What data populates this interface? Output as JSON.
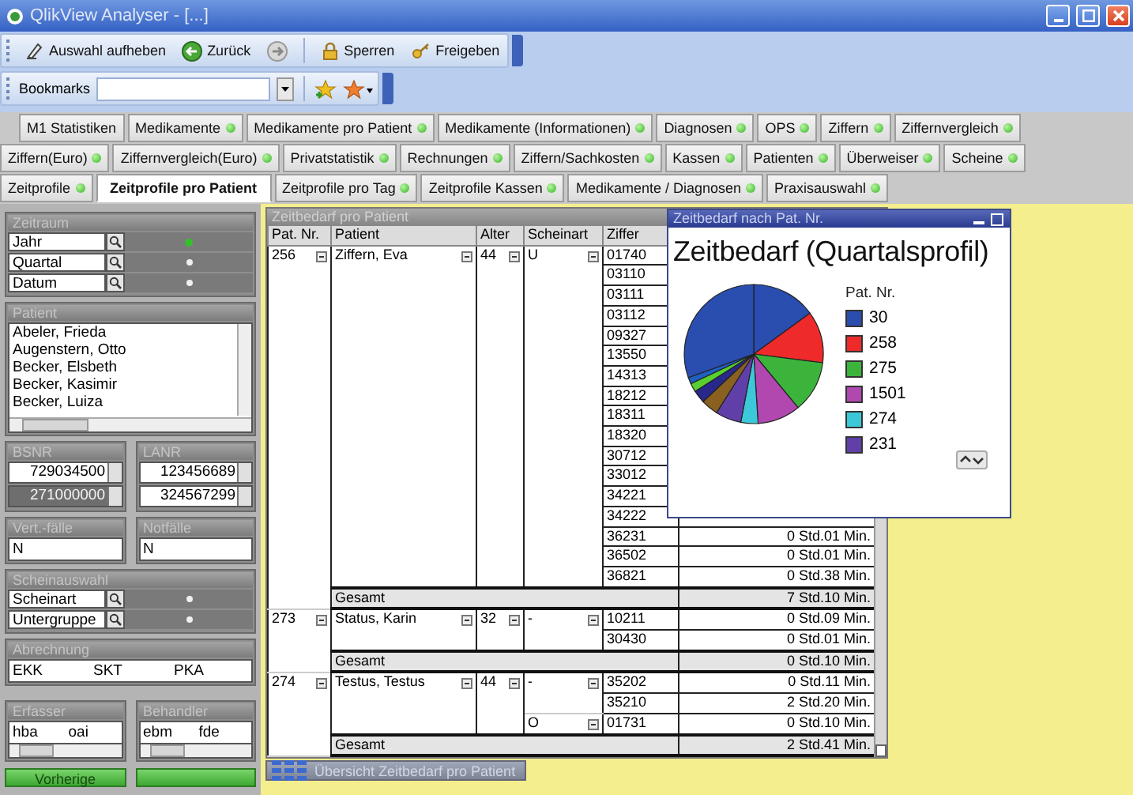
{
  "window": {
    "title": "QlikView Analyser - [...]"
  },
  "toolbar": {
    "groups": [
      [
        {
          "kind": "clear",
          "label": "Auswahl aufheben"
        },
        {
          "kind": "back",
          "label": "Zurück"
        },
        {
          "kind": "forward"
        }
      ],
      [
        {
          "kind": "lock",
          "label": "Sperren"
        },
        {
          "kind": "unlock",
          "label": "Freigeben"
        }
      ]
    ]
  },
  "bookmarks": {
    "label": "Bookmarks"
  },
  "tab_rows": [
    {
      "tabs": [
        {
          "label": "M1 Statistiken",
          "selected": false,
          "dot": false
        },
        {
          "label": "Medikamente",
          "selected": false,
          "dot": true
        },
        {
          "label": "Medikamente pro Patient",
          "selected": false,
          "dot": true
        },
        {
          "label": "Medikamente (Informationen)",
          "selected": false,
          "dot": true
        },
        {
          "label": "Diagnosen",
          "selected": false,
          "dot": true
        },
        {
          "label": "OPS",
          "selected": false,
          "dot": true
        },
        {
          "label": "Ziffern",
          "selected": false,
          "dot": true
        },
        {
          "label": "Ziffernvergleich",
          "selected": false,
          "dot": true
        }
      ]
    },
    {
      "tabs": [
        {
          "label": "Ziffern(Euro)",
          "selected": false,
          "dot": true
        },
        {
          "label": "Ziffernvergleich(Euro)",
          "selected": false,
          "dot": true
        },
        {
          "label": "Privatstatistik",
          "selected": false,
          "dot": true
        },
        {
          "label": "Rechnungen",
          "selected": false,
          "dot": true
        },
        {
          "label": "Ziffern/Sachkosten",
          "selected": false,
          "dot": true
        },
        {
          "label": "Kassen",
          "selected": false,
          "dot": true
        },
        {
          "label": "Patienten",
          "selected": false,
          "dot": true
        },
        {
          "label": "Überweiser",
          "selected": false,
          "dot": true
        },
        {
          "label": "Scheine",
          "selected": false,
          "dot": true
        }
      ]
    },
    {
      "tabs": [
        {
          "label": "Zeitprofile",
          "selected": false,
          "dot": true
        },
        {
          "label": "Zeitprofile pro Patient",
          "selected": true,
          "dot": false
        },
        {
          "label": "Zeitprofile pro Tag",
          "selected": false,
          "dot": true
        },
        {
          "label": "Zeitprofile Kassen",
          "selected": false,
          "dot": true
        },
        {
          "label": "Medikamente / Diagnosen",
          "selected": false,
          "dot": true
        },
        {
          "label": "Praxisauswahl",
          "selected": false,
          "dot": true
        }
      ]
    }
  ],
  "sidebar": {
    "rows": [
      {
        "boxes": [
          {
            "kind": "fields",
            "title": "Zeitraum",
            "fields": [
              {
                "label": "Jahr",
                "active": true
              },
              {
                "label": "Quartal",
                "active": false
              },
              {
                "label": "Datum",
                "active": false
              }
            ]
          }
        ]
      },
      {
        "boxes": [
          {
            "kind": "list",
            "title": "Patient",
            "items": [
              "Abeler, Frieda",
              "Augenstern, Otto",
              "Becker, Elsbeth",
              "Becker, Kasimir",
              "Becker, Luiza"
            ]
          }
        ]
      },
      {
        "boxes": [
          {
            "kind": "stack",
            "title": "BSNR",
            "values": [
              {
                "value": "729034500",
                "excluded": false
              },
              {
                "value": "271000000",
                "excluded": true
              }
            ]
          },
          {
            "kind": "stack",
            "title": "LANR",
            "values": [
              {
                "value": "123456689",
                "excluded": false
              },
              {
                "value": "324567299",
                "excluded": false
              }
            ]
          }
        ]
      },
      {
        "boxes": [
          {
            "kind": "value",
            "title": "Vert.-fälle",
            "value": "N"
          },
          {
            "kind": "value",
            "title": "Notfälle",
            "value": "N"
          }
        ]
      },
      {
        "boxes": [
          {
            "kind": "fields",
            "title": "Scheinauswahl",
            "fields": [
              {
                "label": "Scheinart",
                "active": false
              },
              {
                "label": "Untergruppe",
                "active": false
              }
            ]
          }
        ]
      },
      {
        "boxes": [
          {
            "kind": "cells",
            "title": "Abrechnung",
            "values": [
              "EKK",
              "SKT",
              "PKA"
            ]
          }
        ]
      },
      {
        "boxes": [
          {
            "kind": "scroll_cells",
            "title": "Erfasser",
            "values": [
              "hba",
              "oai"
            ]
          },
          {
            "kind": "scroll_cells",
            "title": "Behandler",
            "values": [
              "ebm",
              "fde"
            ]
          }
        ]
      }
    ],
    "buttons": [
      "Vorherige"
    ]
  },
  "table": {
    "title": "Zeitbedarf pro Patient",
    "columns": [
      "Pat. Nr.",
      "Patient",
      "Alter",
      "Scheinart",
      "Ziffer"
    ],
    "groups": [
      {
        "pat_nr": "256",
        "patient": "Ziffern, Eva",
        "alter": "44",
        "scheine": [
          {
            "scheinart": "U",
            "lines": [
              {
                "ziffer": "01740"
              },
              {
                "ziffer": "03110"
              },
              {
                "ziffer": "03111"
              },
              {
                "ziffer": "03112"
              },
              {
                "ziffer": "09327"
              },
              {
                "ziffer": "13550"
              },
              {
                "ziffer": "14313"
              },
              {
                "ziffer": "18212"
              },
              {
                "ziffer": "18311"
              },
              {
                "ziffer": "18320"
              },
              {
                "ziffer": "30712"
              },
              {
                "ziffer": "33012"
              },
              {
                "ziffer": "34221"
              },
              {
                "ziffer": "34222"
              },
              {
                "ziffer": "36231",
                "value": "0 Std.01 Min."
              },
              {
                "ziffer": "36502",
                "value": "0 Std.01 Min."
              },
              {
                "ziffer": "36821",
                "value": "0 Std.38 Min."
              }
            ]
          }
        ],
        "total_label": "Gesamt",
        "total": "7 Std.10 Min."
      },
      {
        "pat_nr": "273",
        "patient": "Status, Karin",
        "alter": "32",
        "scheine": [
          {
            "scheinart": "-",
            "lines": [
              {
                "ziffer": "10211",
                "value": "0 Std.09 Min."
              },
              {
                "ziffer": "30430",
                "value": "0 Std.01 Min."
              }
            ]
          }
        ],
        "total_label": "Gesamt",
        "total": "0 Std.10 Min."
      },
      {
        "pat_nr": "274",
        "patient": "Testus, Testus",
        "alter": "44",
        "scheine": [
          {
            "scheinart": "-",
            "lines": [
              {
                "ziffer": "35202",
                "value": "0 Std.11 Min."
              },
              {
                "ziffer": "35210",
                "value": "2 Std.20 Min."
              }
            ]
          },
          {
            "scheinart": "O",
            "lines": [
              {
                "ziffer": "01731",
                "value": "0 Std.10 Min."
              }
            ]
          }
        ],
        "total_label": "Gesamt",
        "total": "2 Std.41 Min."
      }
    ]
  },
  "chart_window": {
    "title": "Zeitbedarf nach Pat. Nr.",
    "heading": "Zeitbedarf (Quartalsprofil)",
    "legend_title": "Pat. Nr.",
    "legend": [
      {
        "label": "30",
        "color": "#2a4db0"
      },
      {
        "label": "258",
        "color": "#ee2a2a"
      },
      {
        "label": "275",
        "color": "#3cb43c"
      },
      {
        "label": "1501",
        "color": "#b048b0"
      },
      {
        "label": "274",
        "color": "#3cc8d8"
      },
      {
        "label": "231",
        "color": "#6040a8"
      }
    ]
  },
  "overview_button": {
    "label": "Übersicht Zeitbedarf pro Patient"
  }
}
